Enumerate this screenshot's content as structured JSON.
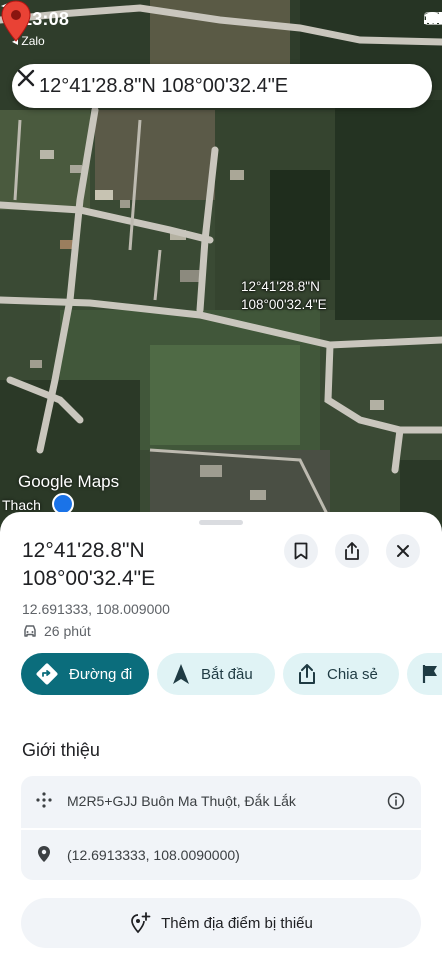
{
  "status_bar": {
    "time": "13:08",
    "back_label": "◂ Zalo"
  },
  "search": {
    "query": "12°41'28.8\"N 108°00'32.4\"E"
  },
  "map": {
    "pin_label_line1": "12°41'28.8\"N",
    "pin_label_line2": "108°00'32.4\"E",
    "logo_text": "Google Maps",
    "place_label": "Thach",
    "pin_color": "#e94235"
  },
  "sheet": {
    "title_line1": "12°41'28.8\"N",
    "title_line2": "108°00'32.4\"E",
    "decimal_coords": "12.691333, 108.009000",
    "drive_time": "26 phút",
    "actions": {
      "directions": "Đường đi",
      "start": "Bắt đầu",
      "share": "Chia sẻ"
    },
    "section_title": "Giới thiệu",
    "plus_code": "M2R5+GJJ Buôn Ma Thuột, Đắk Lắk",
    "precise_coords": "(12.6913333, 108.0090000)",
    "add_place": "Thêm địa điểm bị thiếu"
  },
  "colors": {
    "primary_action": "#0b6d7c",
    "secondary_action": "#e0f3f5",
    "card_background": "#f1f4f8"
  },
  "icons": [
    "location-arrow-icon",
    "signal-icon",
    "wifi-icon",
    "battery-icon",
    "close-icon",
    "map-pin-icon",
    "navigation-icon",
    "bookmark-icon",
    "share-icon",
    "directions-icon",
    "navigate-arrow-icon",
    "flag-icon",
    "plus-code-icon",
    "location-icon",
    "info-icon",
    "add-place-icon",
    "car-icon"
  ]
}
